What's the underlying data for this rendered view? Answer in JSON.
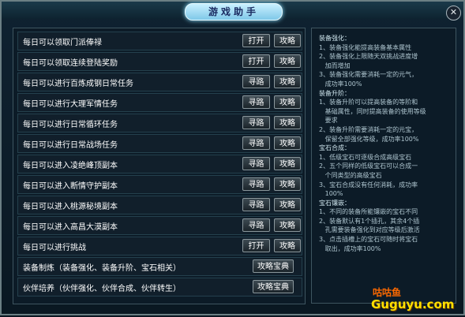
{
  "window": {
    "title": "游戏助手",
    "close_glyph": "✕"
  },
  "tasks": [
    {
      "label": "每日可以领取门派俸禄",
      "action": "打开",
      "guide": "攻略"
    },
    {
      "label": "每日可以领取连续登陆奖励",
      "action": "打开",
      "guide": "攻略"
    },
    {
      "label": "每日可以进行百炼成钢日常任务",
      "action": "寻路",
      "guide": "攻略"
    },
    {
      "label": "每日可以进行大理军情任务",
      "action": "寻路",
      "guide": "攻略"
    },
    {
      "label": "每日可以进行日常循环任务",
      "action": "寻路",
      "guide": "攻略"
    },
    {
      "label": "每日可以进行日常战场任务",
      "action": "寻路",
      "guide": "攻略"
    },
    {
      "label": "每日可以进入凌绝峰顶副本",
      "action": "寻路",
      "guide": "攻略"
    },
    {
      "label": "每日可以进入断情守护副本",
      "action": "寻路",
      "guide": "攻略"
    },
    {
      "label": "每日可以进入桃源秘境副本",
      "action": "寻路",
      "guide": "攻略"
    },
    {
      "label": "每日可以进入高昌大漠副本",
      "action": "寻路",
      "guide": "攻略"
    },
    {
      "label": "每日可以进行挑战",
      "action": "打开",
      "guide": "攻略"
    },
    {
      "label": "装备制炼（装备强化、装备升阶、宝石相关）",
      "wide_action": "攻略宝典"
    },
    {
      "label": "伙伴培养（伙伴强化、伙伴合成、伙伴转生）",
      "wide_action": "攻略宝典"
    }
  ],
  "help": {
    "lines": [
      "装备强化：",
      "1、装备强化能提高装备基本属性",
      "2、装备强化上限随天双挑战进度增",
      "   加而增加",
      "3、装备强化需要消耗一定的元气，",
      "   成功率100%",
      "装备升阶：",
      "1、装备升阶可以提高装备的等阶和",
      "   基础属性，同时提高装备的使用等级",
      "   要求",
      "2、装备升阶需要消耗一定的元宝，",
      "   保留全部强化等级，成功率100%",
      "宝石合成：",
      "1、低级宝石可逐级合成高级宝石",
      "2、五个同样的低级宝石可以合成一",
      "   个同类型的高级宝石",
      "3、宝石合成没有任何消耗，成功率",
      "   100%",
      "宝石镶嵌：",
      "1、不同的装备所能镶嵌的宝石不同",
      "2、装备默认有1个插孔，其余4个插",
      "   孔需要装备强化到对应等级后激活",
      "3、点击插槽上的宝石可随时将宝石",
      "   取出，成功率100%"
    ]
  },
  "watermark": {
    "top": "咕咕鱼",
    "bottom": "Guguyu.com"
  }
}
